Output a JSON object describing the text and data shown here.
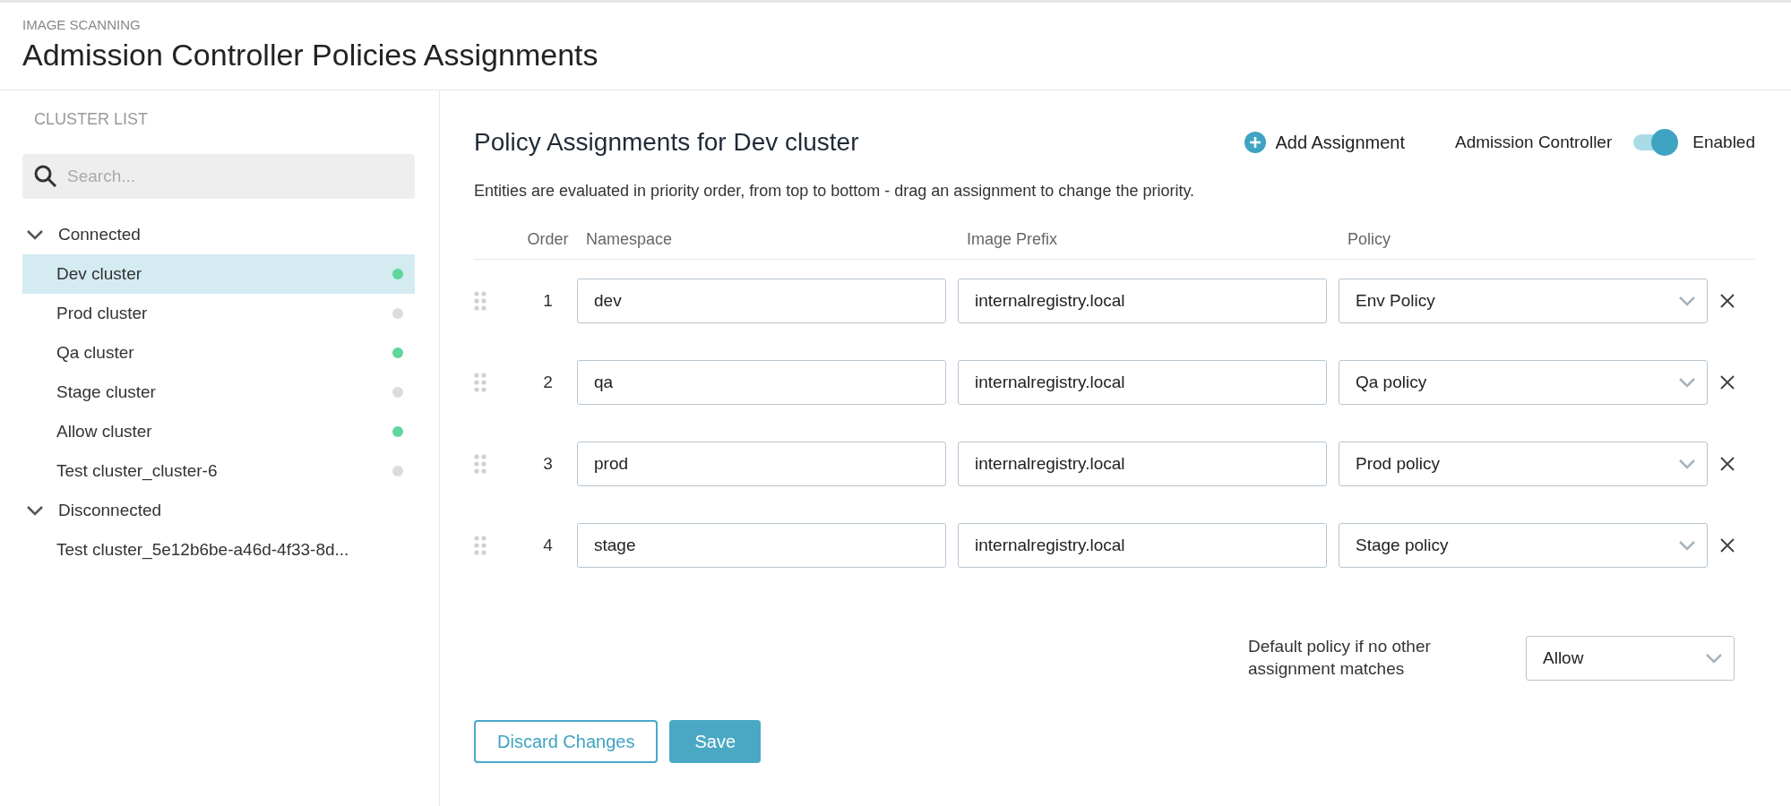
{
  "header": {
    "section": "IMAGE SCANNING",
    "title": "Admission Controller Policies Assignments"
  },
  "sidebar": {
    "heading": "CLUSTER LIST",
    "search": {
      "placeholder": "Search..."
    },
    "groups": [
      {
        "label": "Connected",
        "expanded": true,
        "items": [
          {
            "name": "Dev cluster",
            "selected": true,
            "color": "#5fd69b"
          },
          {
            "name": "Prod cluster",
            "selected": false,
            "color": "#dcdcdc"
          },
          {
            "name": "Qa cluster",
            "selected": false,
            "color": "#5fd69b"
          },
          {
            "name": "Stage cluster",
            "selected": false,
            "color": "#dcdcdc"
          },
          {
            "name": "Allow cluster",
            "selected": false,
            "color": "#5fd69b"
          },
          {
            "name": "Test cluster_cluster-6",
            "selected": false,
            "color": "#dcdcdc"
          }
        ]
      },
      {
        "label": "Disconnected",
        "expanded": true,
        "items": [
          {
            "name": "Test cluster_5e12b6be-a46d-4f33-8d...",
            "selected": false
          }
        ]
      }
    ]
  },
  "main": {
    "title": "Policy Assignments for Dev cluster",
    "add_button": "Add Assignment",
    "toggle": {
      "label": "Admission Controller",
      "on": true,
      "state_label": "Enabled"
    },
    "description": "Entities are evaluated in priority order, from top to bottom - drag an assignment to change the priority.",
    "columns": [
      "Order",
      "Namespace",
      "Image Prefix",
      "Policy"
    ],
    "rows": [
      {
        "order": "1",
        "namespace": "dev",
        "image_prefix": "internalregistry.local",
        "policy": "Env Policy"
      },
      {
        "order": "2",
        "namespace": "qa",
        "image_prefix": "internalregistry.local",
        "policy": "Qa policy"
      },
      {
        "order": "3",
        "namespace": "prod",
        "image_prefix": "internalregistry.local",
        "policy": "Prod policy"
      },
      {
        "order": "4",
        "namespace": "stage",
        "image_prefix": "internalregistry.local",
        "policy": "Stage policy"
      }
    ],
    "default_policy": {
      "label": "Default policy if no other assignment matches",
      "value": "Allow"
    },
    "buttons": {
      "discard": "Discard Changes",
      "save": "Save"
    }
  }
}
